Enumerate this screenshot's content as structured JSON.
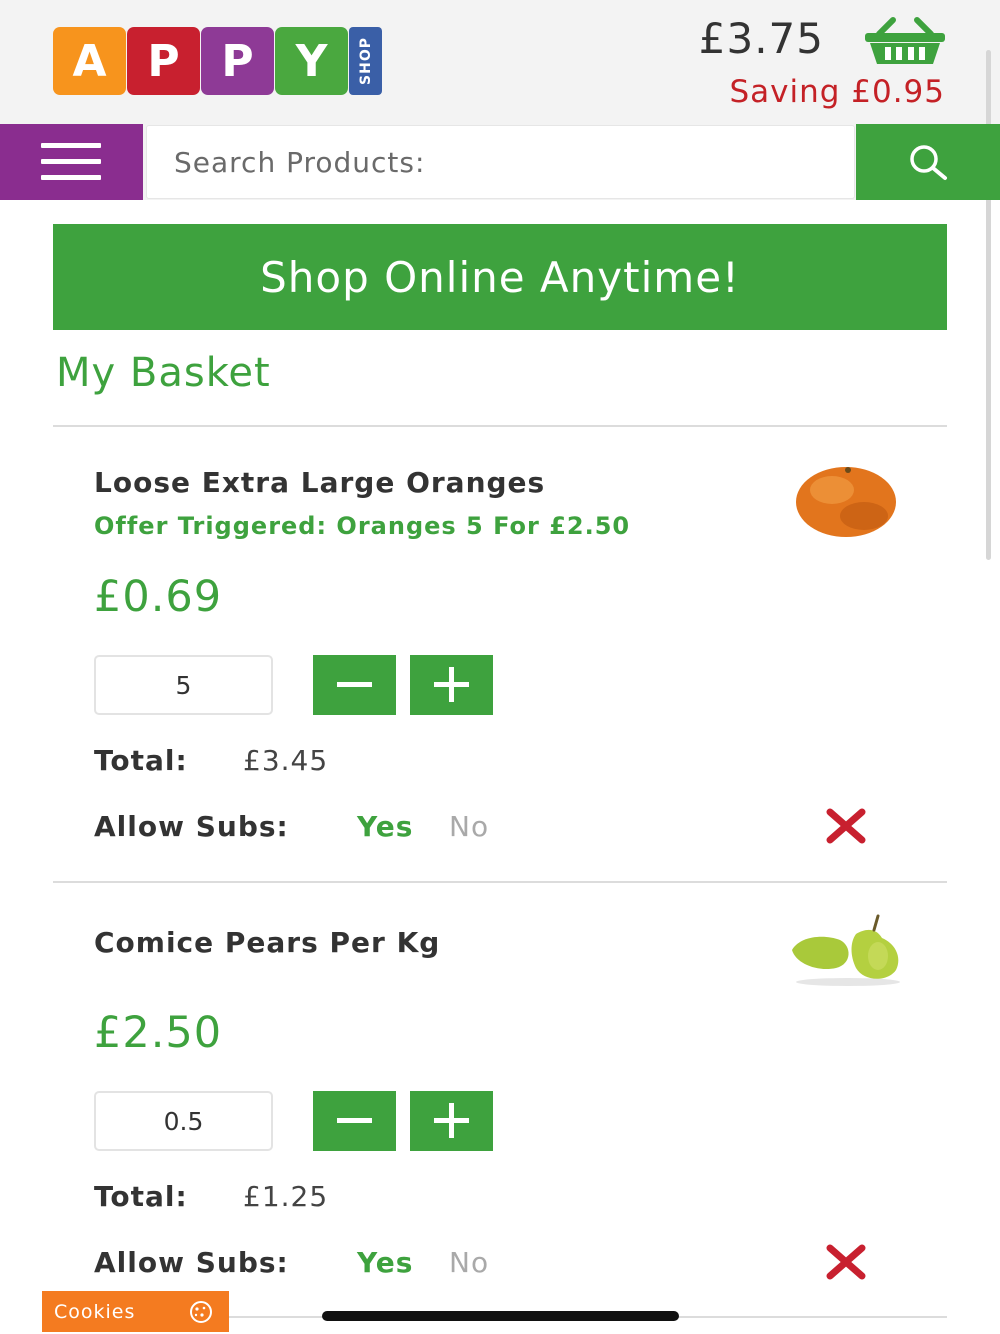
{
  "header": {
    "logo_letters": [
      "A",
      "P",
      "P",
      "Y"
    ],
    "logo_colors": [
      "#f7941d",
      "#c8202f",
      "#8e3a96",
      "#4aa83f"
    ],
    "logo_shop": "SHOP",
    "basket_total": "£3.75",
    "basket_icon": "shopping-basket-icon",
    "saving": "Saving £0.95"
  },
  "search": {
    "menu_icon": "hamburger-menu-icon",
    "placeholder": "Search Products:",
    "value": "",
    "search_icon": "search-icon"
  },
  "banner": {
    "text": "Shop Online Anytime!"
  },
  "basket": {
    "title": "My Basket",
    "items": [
      {
        "name": "Loose Extra Large Oranges",
        "offer": "Offer Triggered: Oranges 5 For £2.50",
        "price": "£0.69",
        "quantity": "5",
        "total_label": "Total:",
        "total": "£3.45",
        "subs_label": "Allow Subs:",
        "subs_yes": "Yes",
        "subs_no": "No",
        "subs_selected": "Yes",
        "image_icon": "orange-image"
      },
      {
        "name": "Comice Pears Per Kg",
        "offer": "",
        "price": "£2.50",
        "quantity": "0.5",
        "total_label": "Total:",
        "total": "£1.25",
        "subs_label": "Allow Subs:",
        "subs_yes": "Yes",
        "subs_no": "No",
        "subs_selected": "Yes",
        "image_icon": "pears-image"
      }
    ]
  },
  "cookies": {
    "label": "Cookies",
    "icon": "cookie-icon"
  },
  "colors": {
    "accent_green": "#3ea23e",
    "menu_purple": "#8a2d8f",
    "saving_red": "#c42126",
    "cookies_orange": "#f47b20"
  }
}
